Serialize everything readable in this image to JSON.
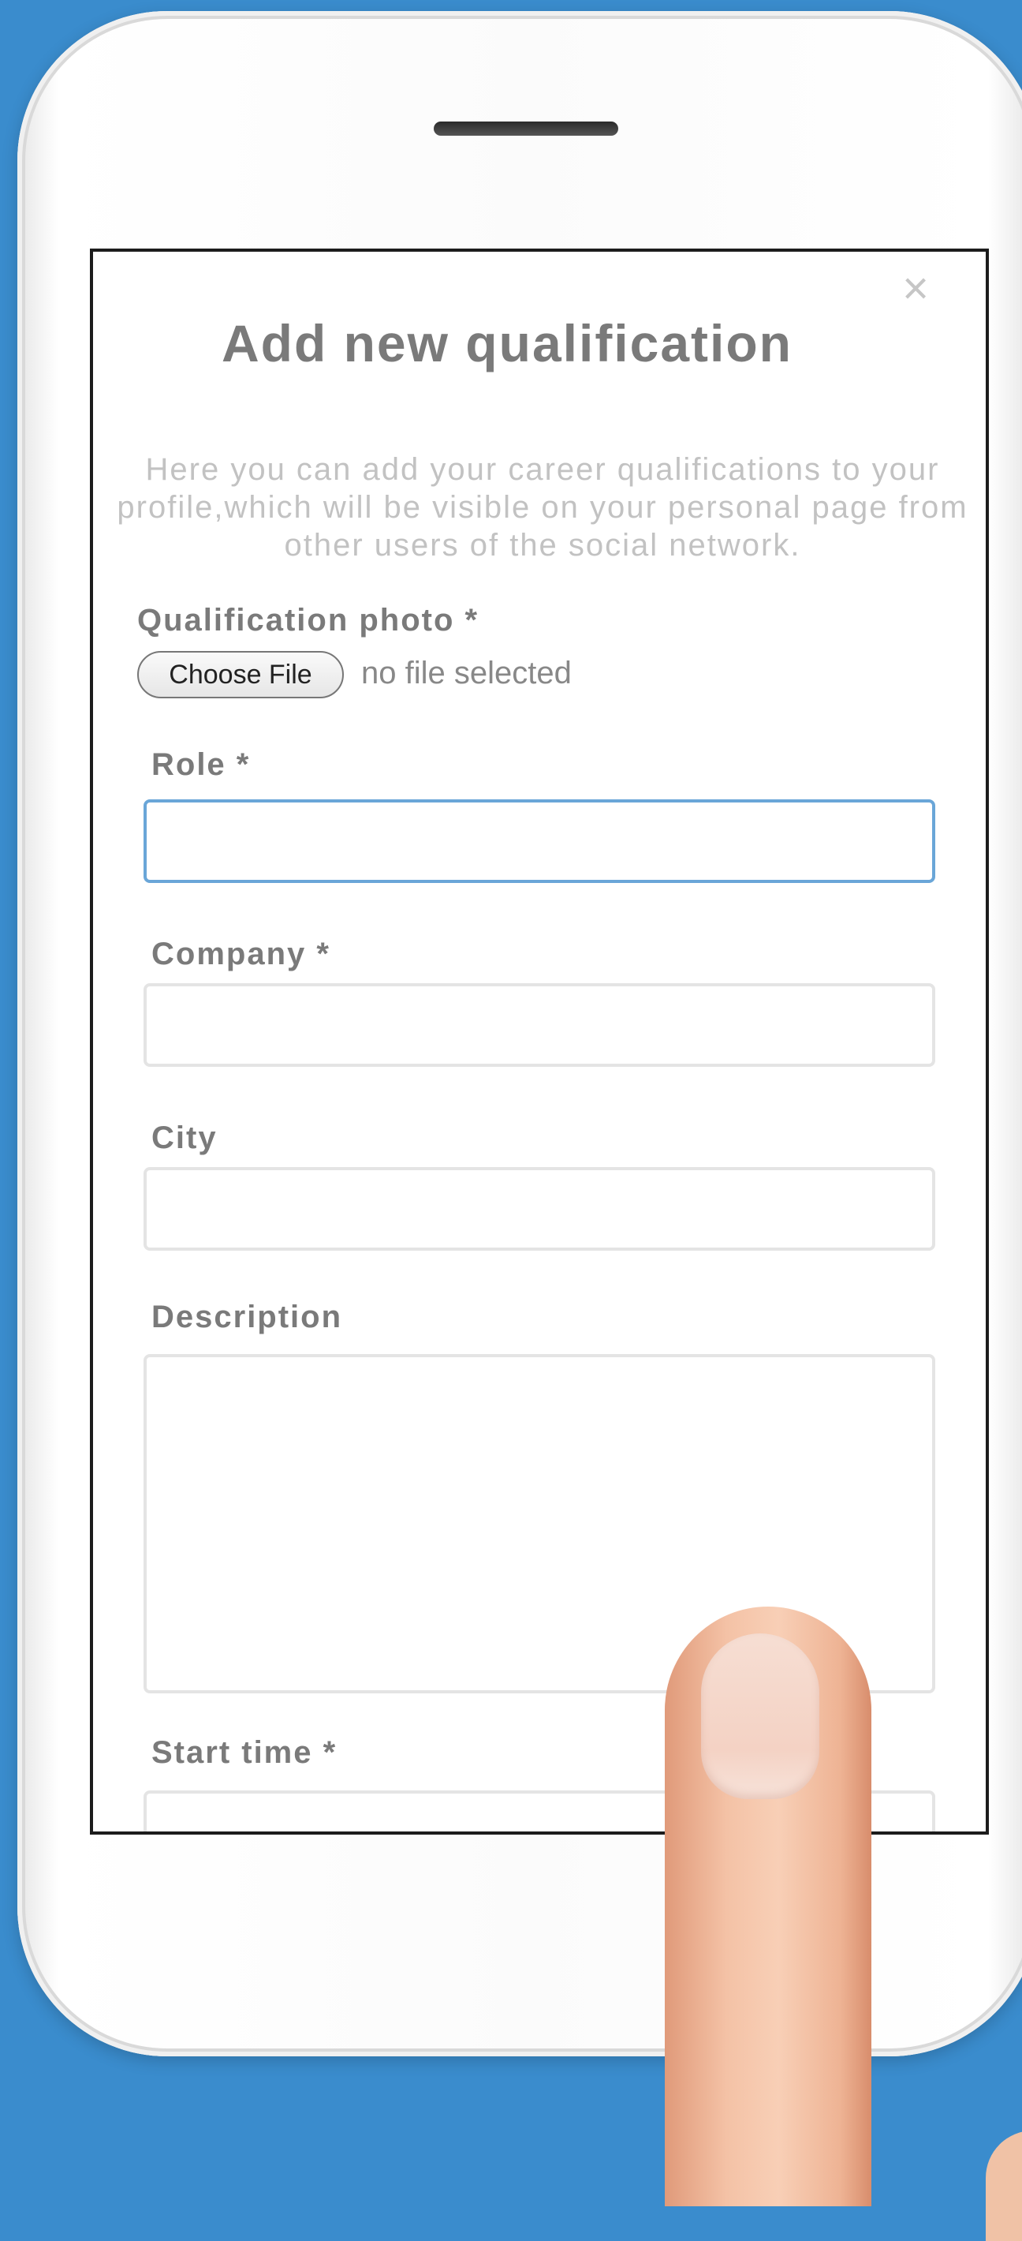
{
  "modal": {
    "close_symbol": "×",
    "title": "Add new qualification",
    "description": "Here you can add your career qualifications to your profile,which will be visible on your personal page from other users of the social network."
  },
  "form": {
    "photo_label": "Qualification photo *",
    "choose_file_label": "Choose File",
    "file_status": "no file selected",
    "role_label": "Role *",
    "role_value": "",
    "company_label": "Company *",
    "company_value": "",
    "city_label": "City",
    "city_value": "",
    "description_label": "Description",
    "description_value": "",
    "start_time_label": "Start time *",
    "start_time_value": ""
  },
  "colors": {
    "background": "#3a8ccd",
    "focus_border": "#6aa6d8",
    "label_text": "#7a7a7a",
    "hint_text": "#c2c2c2"
  }
}
